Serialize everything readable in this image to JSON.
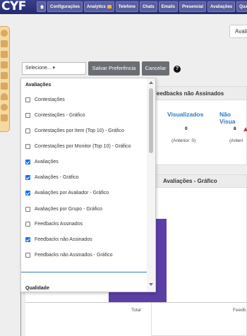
{
  "app": {
    "logo": "CYF"
  },
  "nav": {
    "home_icon": "home-icon",
    "items": [
      {
        "label": "Configurações",
        "locked": false
      },
      {
        "label": "Analytics",
        "locked": true
      },
      {
        "label": "Telefone",
        "locked": false
      },
      {
        "label": "Chats",
        "locked": false
      },
      {
        "label": "Emails",
        "locked": false
      },
      {
        "label": "Presencial",
        "locked": false
      },
      {
        "label": "Avaliações",
        "locked": false
      },
      {
        "label": "Qua",
        "locked": false
      }
    ]
  },
  "top_right_button": "Avali",
  "filter": {
    "select_value": "Selecione... ▾",
    "save_label": "Salvar Preferência",
    "cancel_label": "Cancelar",
    "help_label": "?"
  },
  "dropdown": {
    "group1": "Avaliações",
    "options": [
      {
        "label": "Contestações",
        "checked": false
      },
      {
        "label": "Contestações - Gráfico",
        "checked": false
      },
      {
        "label": "Contestações por Item (Top 10) - Gráfico",
        "checked": false
      },
      {
        "label": "Contestações por Monitor (Top 10) - Gráfico",
        "checked": false
      },
      {
        "label": "Avaliações",
        "checked": true
      },
      {
        "label": "Avaliações - Gráfico",
        "checked": true
      },
      {
        "label": "Avaliações por Avaliador - Gráfico",
        "checked": true
      },
      {
        "label": "Avaliações por Grupo - Gráfico",
        "checked": false
      },
      {
        "label": "Feedbacks Assinados",
        "checked": false
      },
      {
        "label": "Feedbacks não Assinados",
        "checked": true
      },
      {
        "label": "Feedbacks não Assinados - Gráfico",
        "checked": false
      }
    ],
    "group2": "Qualidade"
  },
  "widget_feedbacks": {
    "title": "Feedbacks não Assinados",
    "stats": [
      {
        "label": "Visualizados",
        "value": "0",
        "previous": "(Anterior: 0)"
      },
      {
        "label": "Não Visua",
        "value": "8",
        "previous": "(Anteri"
      }
    ]
  },
  "widget_chart": {
    "title": "Avaliações - Gráfico",
    "x_labels": [
      "Total",
      "Feedb"
    ]
  },
  "colors": {
    "nav_bg": "#2e3280",
    "bar": "#5b3fa6",
    "checkbox": "#1a73e8",
    "stat": "#2e79c2"
  }
}
